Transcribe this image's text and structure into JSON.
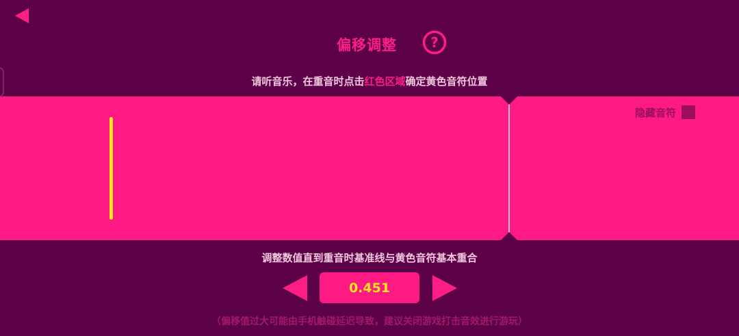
{
  "header": {
    "back_icon": "back-triangle-icon",
    "title": "偏移调整",
    "help_icon": "question-mark-icon"
  },
  "instruction": {
    "prefix": "请听音乐，在重音时点击",
    "highlight": "红色区域",
    "suffix": "确定黄色音符位置"
  },
  "tap_area": {
    "hide_notes_label": "隐藏音符",
    "hide_notes_checked": false,
    "yellow_note_color": "#ffe51c",
    "area_color": "#ff1a84"
  },
  "offset": {
    "hint": "调整数值直到重音时基准线与黄色音符基本重合",
    "value": "0.451",
    "decrease_icon": "left-triangle-icon",
    "increase_icon": "right-triangle-icon"
  },
  "footnote": "（偏移值过大可能由手机触碰延迟导致，建议关闭游戏打击音效进行游玩）",
  "colors": {
    "background": "#5c0048",
    "accent": "#ff1d86",
    "value_text": "#ffe51c"
  }
}
